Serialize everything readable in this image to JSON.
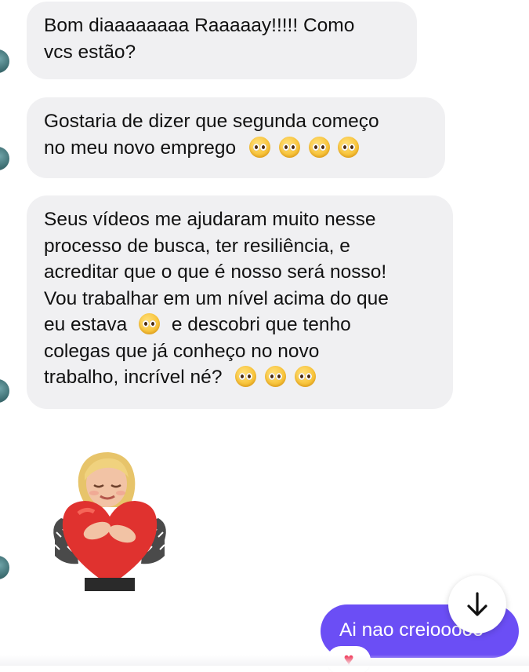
{
  "conversation": {
    "messages": [
      {
        "sender": "incoming",
        "lines": [
          "Bom diaaaaaaaa Raaaaay!!!!! Como",
          "vcs estão?"
        ]
      },
      {
        "sender": "incoming",
        "lines": [
          "Gostaria de dizer que segunda começo",
          "no meu novo emprego"
        ],
        "trailing_emoji": "pleading-face",
        "trailing_emoji_count": 4
      },
      {
        "sender": "incoming",
        "lines": [
          "Seus vídeos me ajudaram muito nesse",
          "processo de busca, ter resiliência, e",
          "acreditar que o que é nosso será nosso!",
          "Vou trabalhar em um nível acima do que",
          "eu estava",
          "e descobri que tenho",
          "colegas que já conheço no novo",
          "trabalho, incrível né?"
        ],
        "inline_emoji": "pleading-face",
        "trailing_emoji_count": 3
      },
      {
        "sender": "incoming",
        "type": "sticker",
        "sticker_icon": "avatar-hugging-heart-sticker"
      },
      {
        "sender": "outgoing",
        "text": "Ai nao creiooooo",
        "reaction": "heart"
      }
    ],
    "scroll_button_icon": "arrow-down-icon"
  },
  "colors": {
    "incoming_bubble": "#f0f0f2",
    "outgoing_bubble": "#6b4ef5",
    "reaction_heart": "#f0284a"
  }
}
